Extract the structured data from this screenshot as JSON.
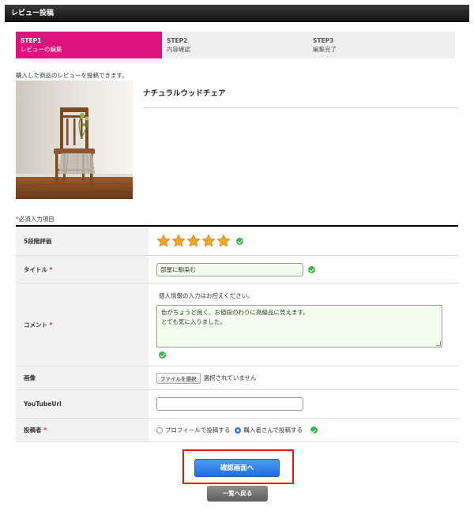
{
  "header": {
    "title": "レビュー投稿"
  },
  "steps": [
    {
      "num": "STEP1",
      "label": "レビューの編集",
      "active": true
    },
    {
      "num": "STEP2",
      "label": "内容確認",
      "active": false
    },
    {
      "num": "STEP3",
      "label": "編集完了",
      "active": false
    }
  ],
  "intro": "購入した商品のレビューを投稿できます。",
  "product": {
    "name": "ナチュラルウッドチェア",
    "image_icon": "wooden-chair-photo"
  },
  "required_note": {
    "mark": "*",
    "text": "必須入力項目"
  },
  "form": {
    "rating": {
      "label": "5段階評価",
      "value": 5,
      "max": 5
    },
    "title": {
      "label": "タイトル",
      "required_mark": "*",
      "value": "部屋に馴染む"
    },
    "comment": {
      "label": "コメント",
      "required_mark": "*",
      "note": "個人情報の入力はお控えください。",
      "value": "色がちょうど良く、お値段のわりに高級品に見えます。\nとても気に入りました。"
    },
    "image": {
      "label": "画像",
      "button": "ファイルを選択",
      "status": "選択されていません"
    },
    "youtube": {
      "label": "YouTubeUrl",
      "value": ""
    },
    "poster": {
      "label": "投稿者",
      "required_mark": "*",
      "options": [
        "プロフィールで投稿する",
        "購入者さんで投稿する"
      ],
      "selected_index": 1
    }
  },
  "buttons": {
    "confirm": "確認画面へ",
    "back": "一覧へ戻る"
  },
  "colors": {
    "accent": "#e0137e",
    "primary_button": "#2d7be5",
    "check": "#3ab34a",
    "highlight_frame": "#e01818"
  }
}
